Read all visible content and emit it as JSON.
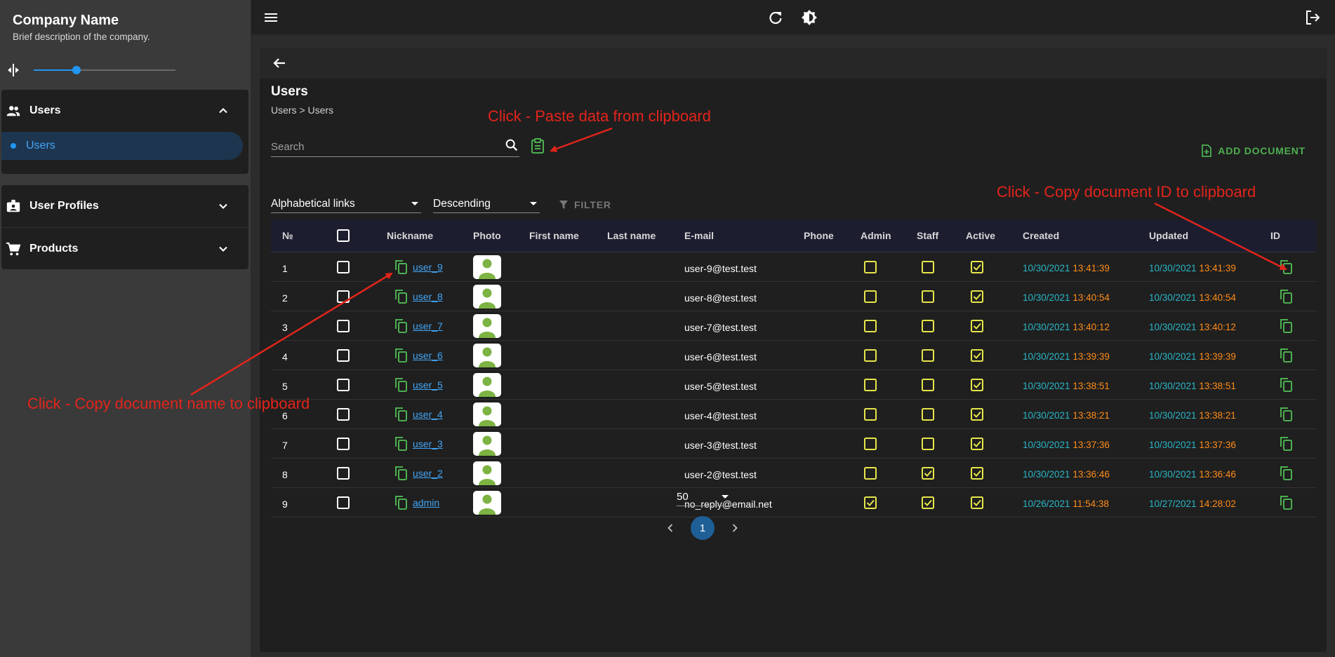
{
  "brand": {
    "name": "Company Name",
    "description": "Brief description of the company."
  },
  "sidebar": {
    "slider_value": 0.3,
    "sections": [
      {
        "label": "Users",
        "icon": "people-icon",
        "expanded": true,
        "items": [
          {
            "label": "Users",
            "active": true
          }
        ]
      },
      {
        "label": "User Profiles",
        "icon": "profile-badge-icon",
        "expanded": false
      },
      {
        "label": "Products",
        "icon": "cart-icon",
        "expanded": false
      }
    ]
  },
  "topbar": {
    "menu_icon": "menu-icon",
    "refresh_icon": "refresh-icon",
    "theme_icon": "brightness-icon",
    "logout_icon": "logout-icon"
  },
  "page": {
    "title": "Users",
    "breadcrumb": "Users > Users"
  },
  "search": {
    "placeholder": "Search",
    "value": ""
  },
  "toolbar": {
    "add_label": "ADD DOCUMENT",
    "filter_label": "FILTER"
  },
  "filters": {
    "sort_field": "Alphabetical links",
    "sort_order": "Descending"
  },
  "table": {
    "columns": [
      "№",
      "",
      "Nickname",
      "Photo",
      "First name",
      "Last name",
      "E-mail",
      "Phone",
      "Admin",
      "Staff",
      "Active",
      "Created",
      "Updated",
      "ID"
    ],
    "rows": [
      {
        "n": "1",
        "nick": "user_9",
        "email": "user-9@test.test",
        "admin": false,
        "staff": false,
        "active": true,
        "cdate": "10/30/2021",
        "ctime": "13:41:39",
        "udate": "10/30/2021",
        "utime": "13:41:39"
      },
      {
        "n": "2",
        "nick": "user_8",
        "email": "user-8@test.test",
        "admin": false,
        "staff": false,
        "active": true,
        "cdate": "10/30/2021",
        "ctime": "13:40:54",
        "udate": "10/30/2021",
        "utime": "13:40:54"
      },
      {
        "n": "3",
        "nick": "user_7",
        "email": "user-7@test.test",
        "admin": false,
        "staff": false,
        "active": true,
        "cdate": "10/30/2021",
        "ctime": "13:40:12",
        "udate": "10/30/2021",
        "utime": "13:40:12"
      },
      {
        "n": "4",
        "nick": "user_6",
        "email": "user-6@test.test",
        "admin": false,
        "staff": false,
        "active": true,
        "cdate": "10/30/2021",
        "ctime": "13:39:39",
        "udate": "10/30/2021",
        "utime": "13:39:39"
      },
      {
        "n": "5",
        "nick": "user_5",
        "email": "user-5@test.test",
        "admin": false,
        "staff": false,
        "active": true,
        "cdate": "10/30/2021",
        "ctime": "13:38:51",
        "udate": "10/30/2021",
        "utime": "13:38:51"
      },
      {
        "n": "6",
        "nick": "user_4",
        "email": "user-4@test.test",
        "admin": false,
        "staff": false,
        "active": true,
        "cdate": "10/30/2021",
        "ctime": "13:38:21",
        "udate": "10/30/2021",
        "utime": "13:38:21"
      },
      {
        "n": "7",
        "nick": "user_3",
        "email": "user-3@test.test",
        "admin": false,
        "staff": false,
        "active": true,
        "cdate": "10/30/2021",
        "ctime": "13:37:36",
        "udate": "10/30/2021",
        "utime": "13:37:36"
      },
      {
        "n": "8",
        "nick": "user_2",
        "email": "user-2@test.test",
        "admin": false,
        "staff": true,
        "active": true,
        "cdate": "10/30/2021",
        "ctime": "13:36:46",
        "udate": "10/30/2021",
        "utime": "13:36:46"
      },
      {
        "n": "9",
        "nick": "admin",
        "email": "no_reply@email.net",
        "admin": true,
        "staff": true,
        "active": true,
        "cdate": "10/26/2021",
        "ctime": "11:54:38",
        "udate": "10/27/2021",
        "utime": "14:28:02"
      }
    ]
  },
  "pagination": {
    "per_page": "50",
    "current_page": "1"
  },
  "annotations": {
    "paste": "Click - Paste data from clipboard",
    "copy_id": "Click - Copy document ID to clipboard",
    "copy_name": "Click - Copy document name to clipboard"
  },
  "colors": {
    "accent_blue": "#2196f3",
    "green": "#4caf50",
    "yellow_check": "#e6e64a",
    "date_cyan": "#29b6c6",
    "time_orange": "#ff8c1a",
    "annotation_red": "#e3241b"
  }
}
